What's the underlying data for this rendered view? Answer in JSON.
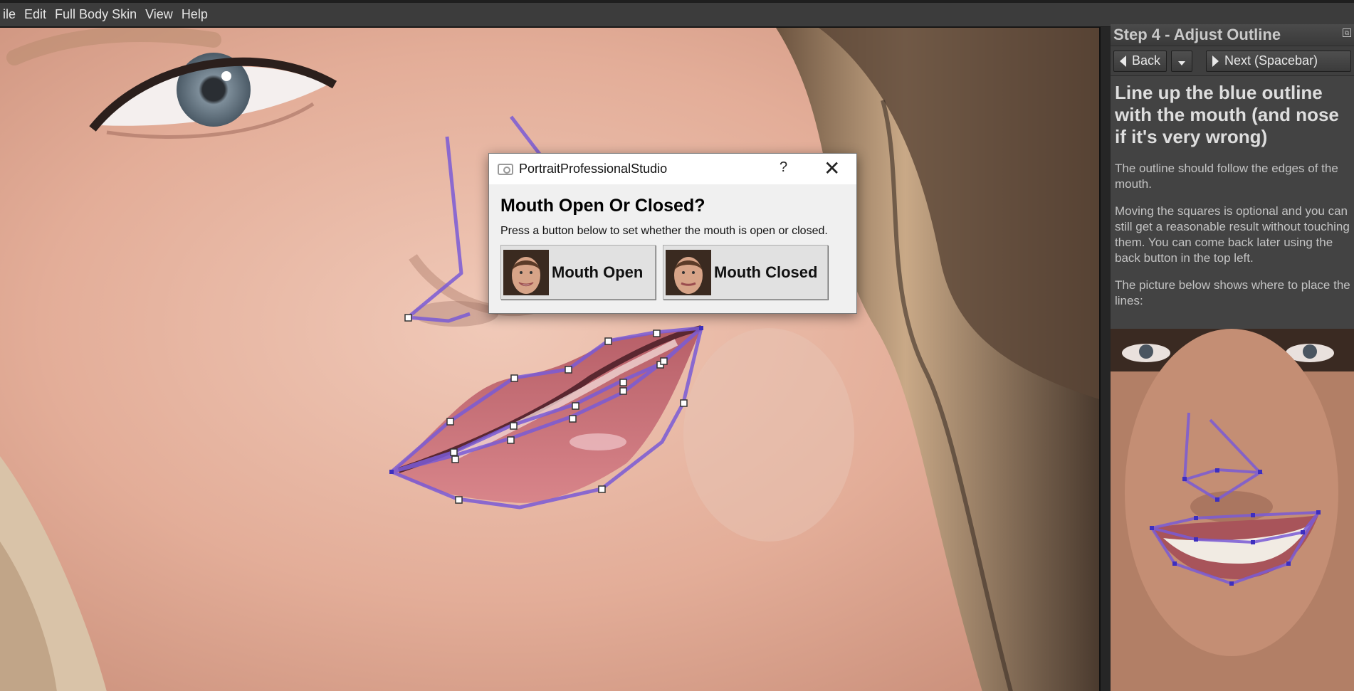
{
  "menu": [
    "ile",
    "Edit",
    "Full Body Skin",
    "View",
    "Help"
  ],
  "panel": {
    "title": "Step 4 - Adjust Outline",
    "back_label": "Back",
    "next_label": "Next (Spacebar)",
    "heading": "Line up the blue outline with the mouth (and nose if it's very wrong)",
    "paragraphs": [
      "The outline should follow the edges of the mouth.",
      "Moving the squares is optional and you can still get a reasonable result without touching them. You can come back later using the back button in the top left.",
      "The picture below shows where to place the lines:"
    ]
  },
  "dialog": {
    "title": "PortraitProfessionalStudio",
    "help": "?",
    "close": "✕",
    "heading": "Mouth Open Or Closed?",
    "text": "Press a button below to set whether the mouth is open or closed.",
    "buttons": {
      "open": "Mouth Open",
      "closed": "Mouth Closed"
    }
  },
  "colors": {
    "outline": "#7a5bd6",
    "panel_bg": "#434343",
    "menu_bg": "#3c3c3c"
  }
}
